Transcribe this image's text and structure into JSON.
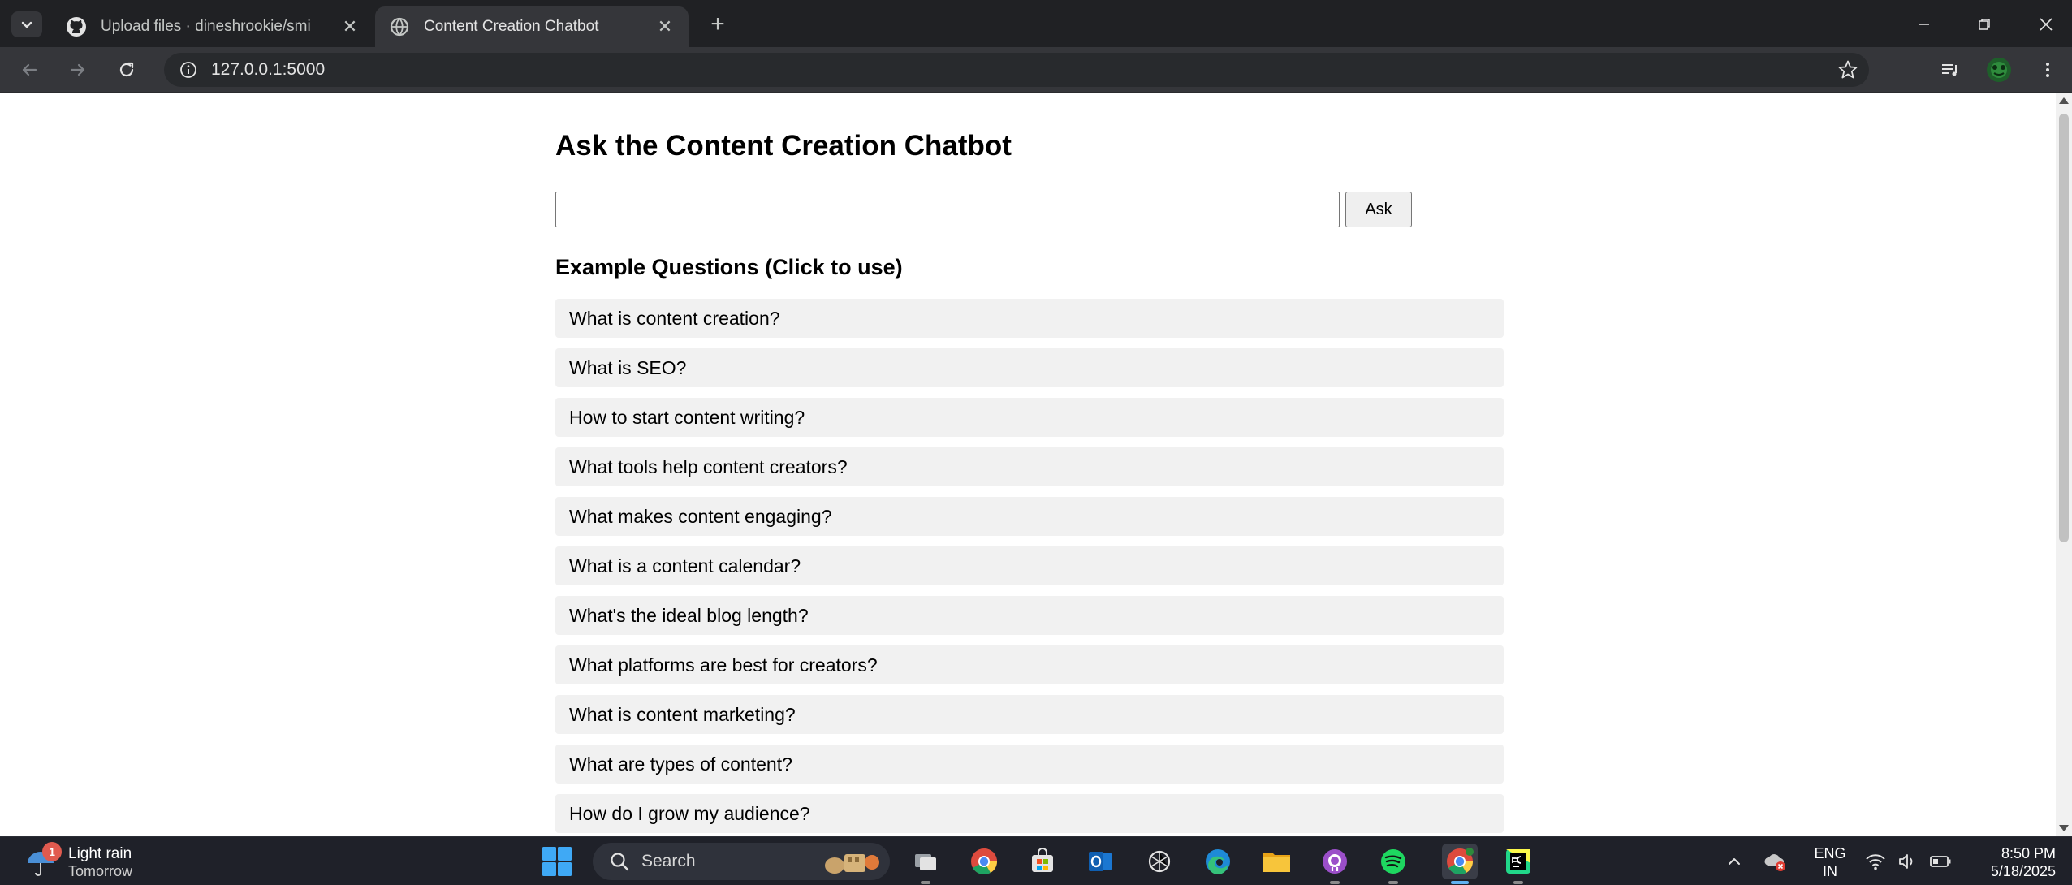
{
  "browser": {
    "tabs": [
      {
        "title": "Upload files · dineshrookie/smi",
        "active": false,
        "favicon": "github-icon"
      },
      {
        "title": "Content Creation Chatbot",
        "active": true,
        "favicon": "globe-icon"
      }
    ],
    "address": "127.0.0.1:5000"
  },
  "page": {
    "title": "Ask the Content Creation Chatbot",
    "input_value": "",
    "ask_label": "Ask",
    "examples_heading": "Example Questions (Click to use)",
    "questions": [
      "What is content creation?",
      "What is SEO?",
      "How to start content writing?",
      "What tools help content creators?",
      "What makes content engaging?",
      "What is a content calendar?",
      "What's the ideal blog length?",
      "What platforms are best for creators?",
      "What is content marketing?",
      "What are types of content?",
      "How do I grow my audience?"
    ]
  },
  "taskbar": {
    "weather": {
      "badge": "1",
      "condition": "Light rain",
      "when": "Tomorrow"
    },
    "search_label": "Search",
    "language": {
      "line1": "ENG",
      "line2": "IN"
    },
    "clock": {
      "time": "8:50 PM",
      "date": "5/18/2025"
    }
  },
  "colors": {
    "tabstrip": "#202124",
    "toolbar": "#35363a",
    "question_bg": "#f1f1f1",
    "taskbar": "#1f2129",
    "active_indicator": "#5fb2f2"
  }
}
